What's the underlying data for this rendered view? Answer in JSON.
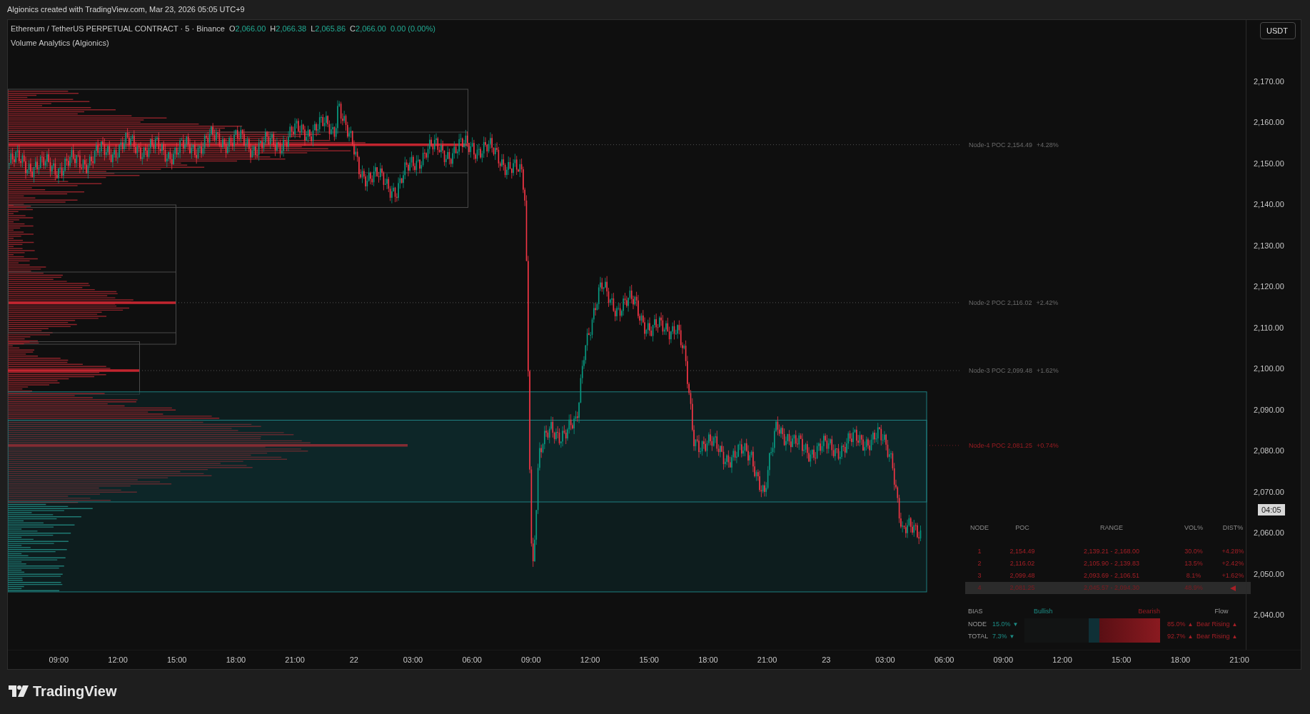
{
  "top_bar": {
    "text": "Algionics created with TradingView.com, Mar 23, 2026 05:05 UTC+9"
  },
  "legend": {
    "symbol": "Ethereum / TetherUS PERPETUAL CONTRACT · 5 · Binance",
    "ohlc": [
      {
        "label": "O",
        "value": "2,066.00"
      },
      {
        "label": "H",
        "value": "2,066.38"
      },
      {
        "label": "L",
        "value": "2,065.86"
      },
      {
        "label": "C",
        "value": "2,066.00"
      }
    ],
    "change": "0.00 (0.00%)",
    "indicator": "Volume Analytics (Algionics)"
  },
  "currency_button": "USDT",
  "price_axis": {
    "labels": [
      "2,170.00",
      "2,160.00",
      "2,150.00",
      "2,140.00",
      "2,130.00",
      "2,120.00",
      "2,110.00",
      "2,100.00",
      "2,090.00",
      "2,080.00",
      "2,070.00",
      "2,060.00",
      "2,050.00",
      "2,040.00"
    ],
    "countdown": "04:05"
  },
  "node_labels": [
    {
      "label": "Node-1 POC 2,154.49",
      "dist": "+4.28%",
      "selected": false
    },
    {
      "label": "Node-2 POC 2,116.02",
      "dist": "+2.42%",
      "selected": false
    },
    {
      "label": "Node-3 POC 2,099.48",
      "dist": "+1.62%",
      "selected": false
    },
    {
      "label": "Node-4 POC 2,081.25",
      "dist": "+0.74%",
      "selected": true
    }
  ],
  "node_table": {
    "columns": [
      "NODE",
      "POC",
      "RANGE",
      "VOL%",
      "DIST%"
    ],
    "rows": [
      {
        "node": "1",
        "poc": "2,154.49",
        "range": "2,139.21 - 2,168.00",
        "vol": "30.0%",
        "dist": "+4.28%",
        "selected": false
      },
      {
        "node": "2",
        "poc": "2,116.02",
        "range": "2,105.90 - 2,139.83",
        "vol": "13.5%",
        "dist": "+2.42%",
        "selected": false
      },
      {
        "node": "3",
        "poc": "2,099.48",
        "range": "2,093.69 - 2,106.51",
        "vol": "8.1%",
        "dist": "+1.62%",
        "selected": false
      },
      {
        "node": "4",
        "poc": "2,081.25",
        "range": "2,045.57 - 2,094.30",
        "vol": "48.9%",
        "selected": true
      }
    ]
  },
  "bias": {
    "headers": [
      "BIAS",
      "Bullish",
      "Bearish",
      "Flow"
    ],
    "rows": [
      {
        "label": "NODE",
        "bull": "15.0%",
        "bull_arrow": "▼",
        "bear": "85.0%",
        "bear_arrow": "▲",
        "flow": "Bear Rising",
        "flow_arrow": "▲"
      },
      {
        "label": "TOTAL",
        "bull": "7.3%",
        "bull_arrow": "▼",
        "bear": "92.7%",
        "bear_arrow": "▲",
        "flow": "Bear Rising",
        "flow_arrow": "▲"
      }
    ],
    "meter": {
      "level": 0.85
    }
  },
  "time_axis": {
    "labels": [
      "09:00",
      "12:00",
      "15:00",
      "18:00",
      "21:00",
      "22",
      "03:00",
      "06:00",
      "09:00",
      "12:00",
      "15:00",
      "18:00",
      "21:00",
      "23",
      "03:00",
      "06:00",
      "09:00",
      "12:00",
      "15:00",
      "18:00",
      "21:00"
    ]
  },
  "footer": {
    "logo": "TradingView"
  }
}
